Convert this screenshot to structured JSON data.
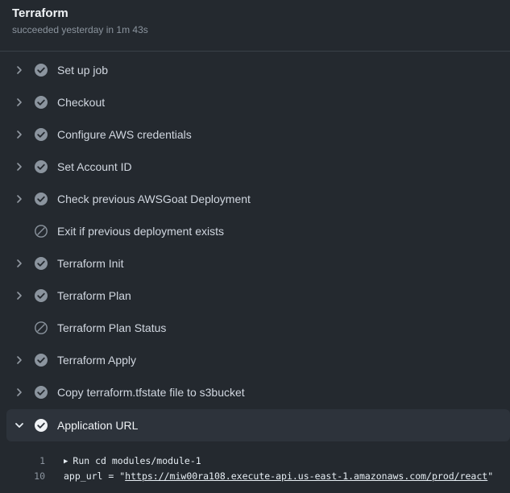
{
  "job": {
    "title": "Terraform",
    "subtitle": "succeeded yesterday in 1m 43s"
  },
  "steps": [
    {
      "label": "Set up job",
      "status": "success",
      "expandable": true
    },
    {
      "label": "Checkout",
      "status": "success",
      "expandable": true
    },
    {
      "label": "Configure AWS credentials",
      "status": "success",
      "expandable": true
    },
    {
      "label": "Set Account ID",
      "status": "success",
      "expandable": true
    },
    {
      "label": "Check previous AWSGoat Deployment",
      "status": "success",
      "expandable": true
    },
    {
      "label": "Exit if previous deployment exists",
      "status": "skipped",
      "expandable": false
    },
    {
      "label": "Terraform Init",
      "status": "success",
      "expandable": true
    },
    {
      "label": "Terraform Plan",
      "status": "success",
      "expandable": true
    },
    {
      "label": "Terraform Plan Status",
      "status": "skipped",
      "expandable": false
    },
    {
      "label": "Terraform Apply",
      "status": "success",
      "expandable": true
    },
    {
      "label": "Copy terraform.tfstate file to s3bucket",
      "status": "success",
      "expandable": true
    },
    {
      "label": "Application URL",
      "status": "success",
      "expandable": true,
      "expanded": true
    }
  ],
  "log": {
    "lines": [
      {
        "num": "1",
        "group_text": "Run cd modules/module-1"
      },
      {
        "num": "10",
        "prefix": "app_url = \"",
        "link": "https://miw00ra108.execute-api.us-east-1.amazonaws.com/prod/react",
        "suffix": "\""
      }
    ]
  },
  "colors": {
    "background": "#24292f",
    "success_icon": "#8b949e",
    "text": "#d1d7e0"
  }
}
